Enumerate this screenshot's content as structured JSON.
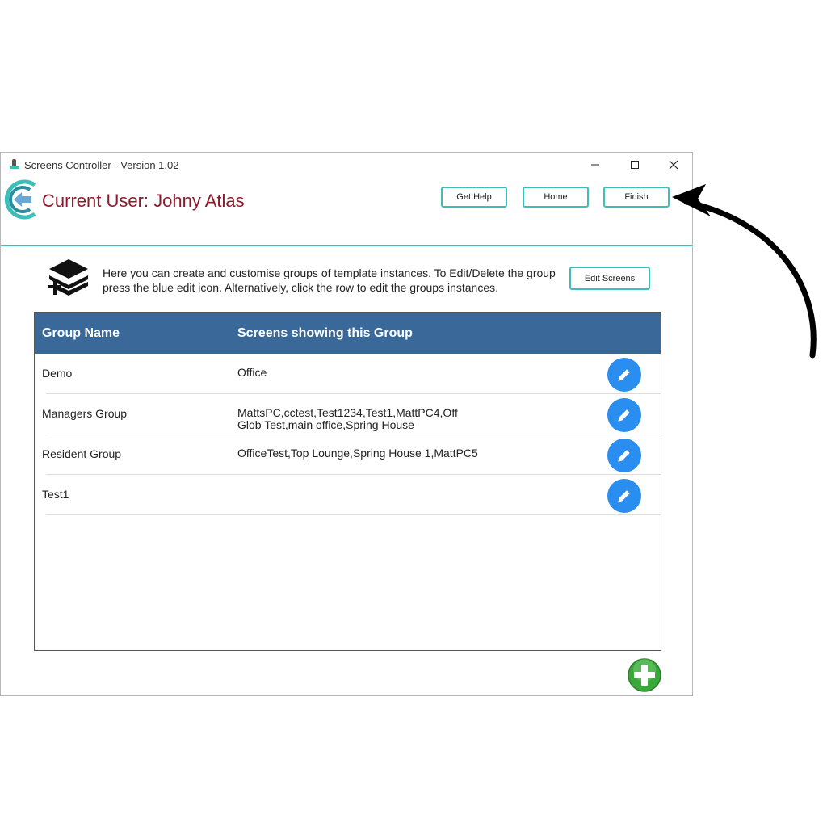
{
  "window": {
    "title": "Screens Controller - Version 1.02"
  },
  "header": {
    "current_user": "Current User: Johny Atlas",
    "buttons": {
      "help": "Get Help",
      "home": "Home",
      "finish": "Finish"
    }
  },
  "info": {
    "text": "Here you can create and customise groups of template instances. To Edit/Delete the group press the blue edit icon. Alternatively, click the row to edit the groups instances.",
    "edit_screens_label": "Edit Screens"
  },
  "table": {
    "columns": [
      "Group Name",
      "Screens showing this Group"
    ],
    "rows": [
      {
        "name": "Demo",
        "screens": "Office"
      },
      {
        "name": "Managers Group",
        "screens": "MattsPC,cctest,Test1234,Test1,MattPC4,Off Glob Test,main office,Spring House"
      },
      {
        "name": "Resident Group",
        "screens": "OfficeTest,Top Lounge,Spring House 1,MattPC5"
      },
      {
        "name": "Test1",
        "screens": ""
      }
    ]
  },
  "colors": {
    "accent": "#3cbfb8",
    "user_label": "#8b1a2b",
    "table_header": "#3a6898",
    "edit_button": "#2a8df0",
    "add_button": "#3aa83a"
  },
  "icons": {
    "app": "app-icon",
    "logo": "back-arrow-logo",
    "info": "layers-add-icon",
    "edit": "pencil-icon",
    "add": "plus-circle-icon",
    "annotation": "curved-arrow"
  }
}
